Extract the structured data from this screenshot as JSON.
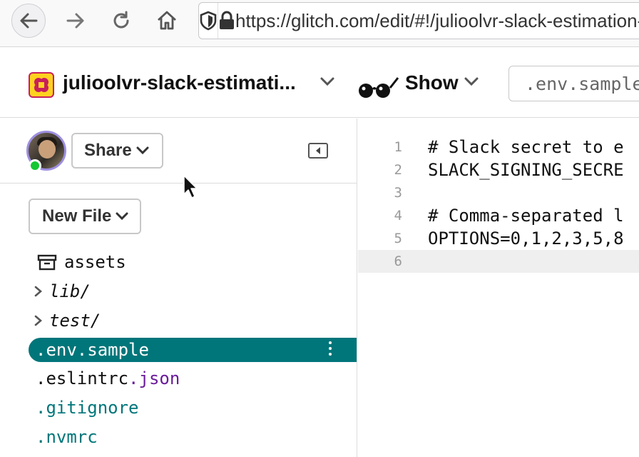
{
  "browser": {
    "url": "https://glitch.com/edit/#!/julioolvr-slack-estimation-bot"
  },
  "header": {
    "project_name": "julioolvr-slack-estimati...",
    "show_label": "Show",
    "current_file": ".env.sample"
  },
  "sidebar": {
    "share_label": "Share",
    "new_file_label": "New File",
    "files": [
      {
        "name": "assets",
        "kind": "assets"
      },
      {
        "name": "lib/",
        "kind": "folder"
      },
      {
        "name": "test/",
        "kind": "folder"
      },
      {
        "name": ".env.sample",
        "kind": "file",
        "selected": true
      },
      {
        "name": ".eslintrc",
        "ext": ".json",
        "kind": "file"
      },
      {
        "name": ".gitignore",
        "kind": "file"
      },
      {
        "name": ".nvmrc",
        "kind": "file"
      }
    ]
  },
  "editor": {
    "lines": [
      {
        "num": "1",
        "text": "# Slack secret to e"
      },
      {
        "num": "2",
        "text": "SLACK_SIGNING_SECRE"
      },
      {
        "num": "3",
        "text": ""
      },
      {
        "num": "4",
        "text": "# Comma-separated l"
      },
      {
        "num": "5",
        "text": "OPTIONS=0,1,2,3,5,8"
      },
      {
        "num": "6",
        "text": ""
      }
    ],
    "active_line": "6"
  },
  "colors": {
    "selected_file_bg": "#00767a",
    "presence_online": "#14c733",
    "logo_yellow": "#ffd21f",
    "logo_magenta": "#c71f5d"
  },
  "icons": [
    "back-arrow-icon",
    "forward-arrow-icon",
    "reload-icon",
    "home-icon",
    "tracking-shield-icon",
    "lock-icon",
    "glitch-logo-icon",
    "sunglasses-icon",
    "chevron-down-icon",
    "collapse-sidebar-icon",
    "assets-box-icon",
    "folder-chevron-icon",
    "more-options-icon",
    "mouse-pointer-icon"
  ]
}
